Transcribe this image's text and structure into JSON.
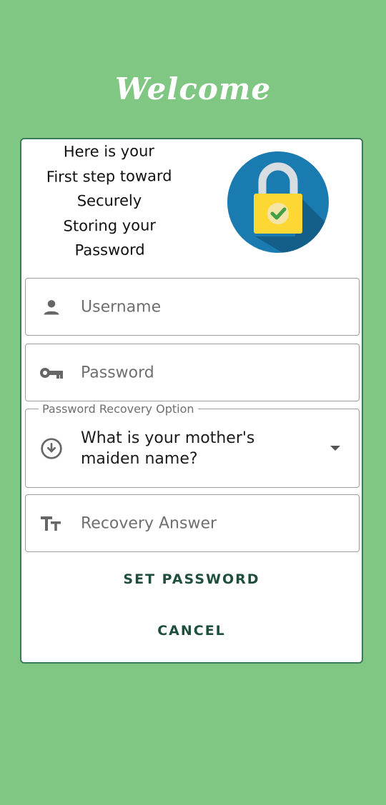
{
  "header": {
    "title": "Welcome"
  },
  "intro": {
    "lines": [
      "Here is your",
      "First step toward",
      "Securely",
      "Storing your",
      "Password"
    ]
  },
  "form": {
    "username": {
      "placeholder": "Username",
      "icon": "person-icon"
    },
    "password": {
      "placeholder": "Password",
      "icon": "key-icon"
    },
    "recovery_option": {
      "legend": "Password Recovery Option",
      "selected": "What is your mother's maiden name?",
      "icon": "arrow-circle-down-icon"
    },
    "recovery_answer": {
      "placeholder": "Recovery Answer",
      "icon": "text-fields-icon"
    }
  },
  "actions": {
    "set_password": "SET PASSWORD",
    "cancel": "CANCEL"
  },
  "colors": {
    "background": "#81c784",
    "card_border": "#3d7a5c",
    "button_text": "#1f4e3d",
    "lock_circle": "#1a7bb0",
    "lock_body": "#fdd835",
    "check": "#43a047"
  }
}
